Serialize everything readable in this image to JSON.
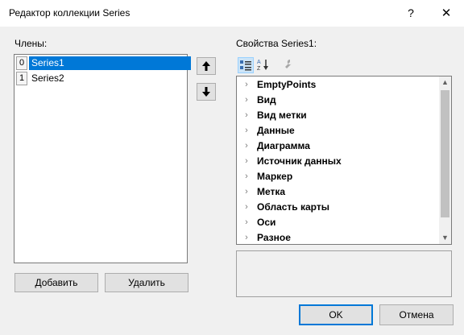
{
  "window": {
    "title": "Редактор коллекции Series",
    "help_glyph": "?",
    "close_glyph": "✕"
  },
  "members": {
    "label": "Члены:",
    "items": [
      {
        "index": "0",
        "name": "Series1",
        "selected": true
      },
      {
        "index": "1",
        "name": "Series2",
        "selected": false
      }
    ],
    "move_up_glyph": "🡅",
    "move_down_glyph": "🡇",
    "add_label": "Добавить",
    "remove_label": "Удалить"
  },
  "properties": {
    "label": "Свойства Series1:",
    "categories": [
      "EmptyPoints",
      "Вид",
      "Вид метки",
      "Данные",
      "Диаграмма",
      "Источник данных",
      "Маркер",
      "Метка",
      "Область карты",
      "Оси",
      "Разное"
    ]
  },
  "footer": {
    "ok_label": "OK",
    "cancel_label": "Отмена"
  },
  "colors": {
    "selection": "#0078d7",
    "default_button_border": "#0078d7"
  }
}
